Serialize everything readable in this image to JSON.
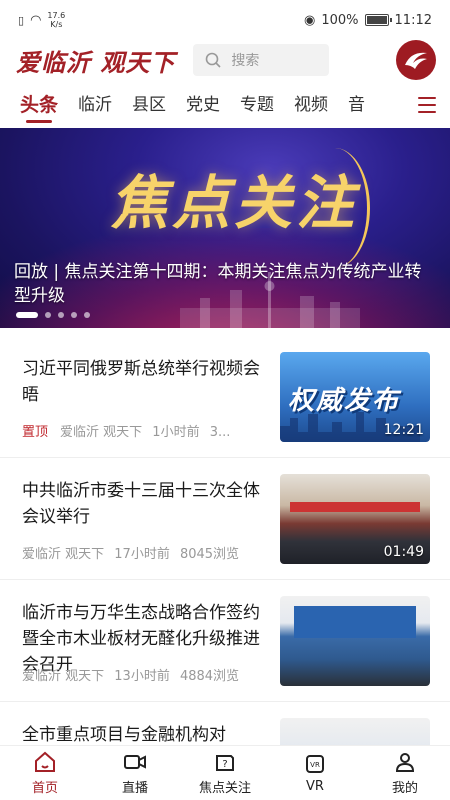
{
  "status_bar": {
    "speed_value": "17.6",
    "speed_unit": "K/s",
    "battery": "100%",
    "time": "11:12"
  },
  "header": {
    "logo_text": "爱临沂 观天下",
    "search_placeholder": "搜索"
  },
  "tabs": [
    {
      "label": "头条",
      "active": true
    },
    {
      "label": "临沂"
    },
    {
      "label": "县区"
    },
    {
      "label": "党史"
    },
    {
      "label": "专题"
    },
    {
      "label": "视频"
    },
    {
      "label": "音"
    }
  ],
  "banner": {
    "art_title": "焦点关注",
    "caption": "回放 | 焦点关注第十四期：本期关注焦点为传统产业转型升级",
    "slide_count": 5,
    "active_slide": 1
  },
  "news": [
    {
      "headline": "习近平同俄罗斯总统举行视频会晤",
      "pinned": "置顶",
      "source": "爱临沂 观天下",
      "time": "1小时前",
      "views": "3...",
      "thumb_text": "权威发布",
      "duration": "12:21"
    },
    {
      "headline": "中共临沂市委十三届十三次全体会议举行",
      "source": "爱临沂 观天下",
      "time": "17小时前",
      "views": "8045浏览",
      "duration": "01:49"
    },
    {
      "headline": "临沂市与万华生态战略合作签约暨全市木业板材无醛化升级推进会召开",
      "source": "爱临沂 观天下",
      "time": "13小时前",
      "views": "4884浏览"
    },
    {
      "headline": "全市重点项目与金融机构对"
    }
  ],
  "bottom_nav": [
    {
      "label": "首页",
      "icon": "home-icon",
      "active": true
    },
    {
      "label": "直播",
      "icon": "video-camera-icon"
    },
    {
      "label": "焦点关注",
      "icon": "focus-icon"
    },
    {
      "label": "VR",
      "icon": "vr-headset-icon"
    },
    {
      "label": "我的",
      "icon": "user-icon"
    }
  ],
  "colors": {
    "accent": "#a32127",
    "pinned": "#c0282e",
    "meta_gray": "#999999"
  }
}
